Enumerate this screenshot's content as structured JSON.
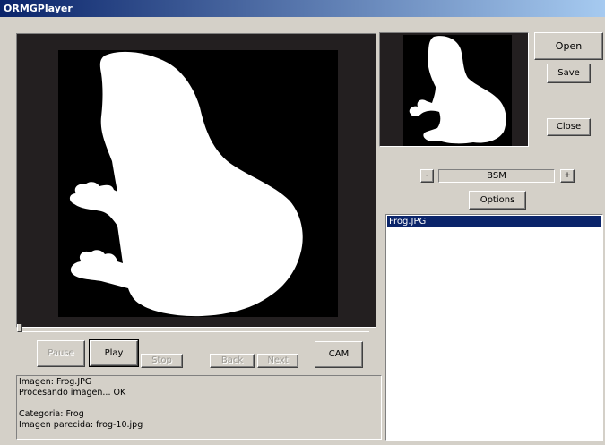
{
  "window": {
    "title": "ORMGPlayer"
  },
  "toolbar": {
    "open_label": "Open",
    "save_label": "Save",
    "close_label": "Close",
    "minus_label": "-",
    "plus_label": "+",
    "mode_value": "BSM",
    "options_label": "Options"
  },
  "playback": {
    "pause_label": "Pause",
    "play_label": "Play",
    "stop_label": "Stop",
    "back_label": "Back",
    "next_label": "Next",
    "cam_label": "CAM"
  },
  "log": {
    "lines": [
      "Imagen: Frog.JPG",
      "Procesando imagen... OK",
      "",
      "Categoria: Frog",
      "Imagen parecida: frog-10.jpg"
    ]
  },
  "files": {
    "items": [
      "Frog.JPG"
    ],
    "selected": "Frog.JPG"
  },
  "colors": {
    "titlebar_start": "#0a246a",
    "titlebar_end": "#a6caf0",
    "selection": "#0a246a",
    "face": "#d4d0c8"
  }
}
